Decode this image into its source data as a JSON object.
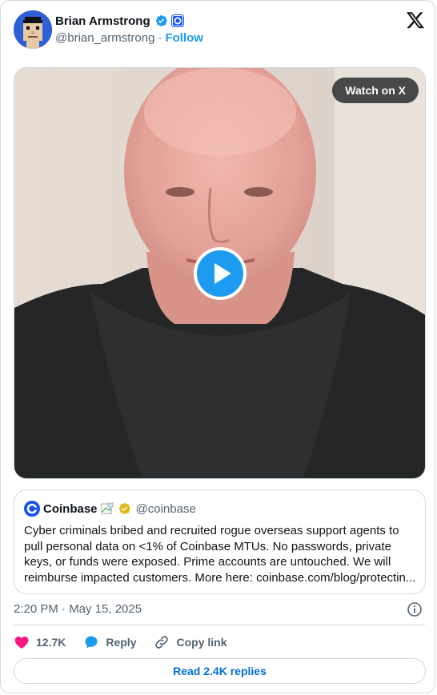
{
  "author": {
    "name": "Brian Armstrong",
    "handle": "@brian_armstrong",
    "separator": "·",
    "follow_label": "Follow",
    "verified_icon": "verified-badge-icon",
    "affiliate_icon": "coinbase-affiliate-icon"
  },
  "media": {
    "watch_label": "Watch on X",
    "play_icon": "play-icon"
  },
  "quote": {
    "name": "Coinbase",
    "handle": "@coinbase",
    "text": "Cyber criminals bribed and recruited rogue overseas support agents to pull personal data on <1% of Coinbase MTUs. No passwords, private keys, or funds were exposed. Prime accounts are untouched. We will reimburse impacted customers. More here: coinbase.com/blog/protectin..."
  },
  "meta": {
    "timestamp": "2:20 PM · May 15, 2025"
  },
  "actions": {
    "like_count": "12.7K",
    "reply_label": "Reply",
    "copy_label": "Copy link"
  },
  "footer": {
    "read_replies_label": "Read 2.4K replies"
  },
  "colors": {
    "accent": "#1d9bf0",
    "like": "#f91880",
    "muted": "#536471",
    "border": "#cfd9de"
  }
}
